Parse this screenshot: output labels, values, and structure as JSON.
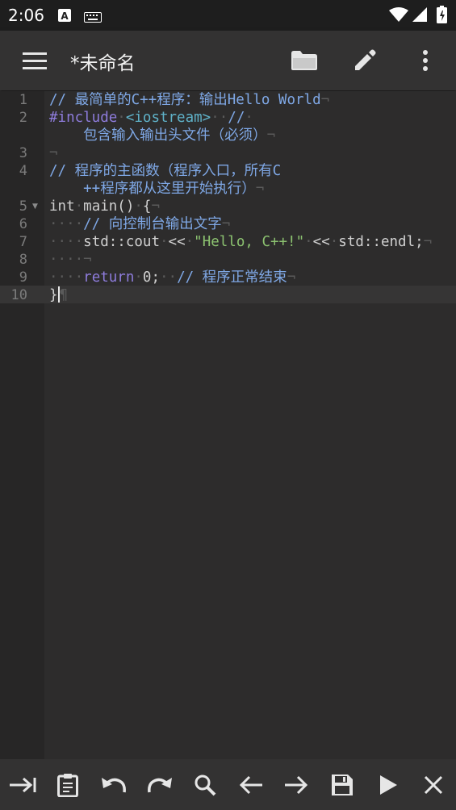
{
  "status_bar": {
    "time": "2:06"
  },
  "app_bar": {
    "title": "*未命名"
  },
  "editor": {
    "line_numbers": [
      "1",
      "2",
      "3",
      "4",
      "5",
      "6",
      "7",
      "8",
      "9",
      "10"
    ],
    "lines": [
      {
        "segments": [
          {
            "cls": "cm",
            "text": "// 最简单的C++程序：输出Hello World"
          },
          {
            "cls": "ws",
            "text": "¬"
          }
        ]
      },
      {
        "segments": [
          {
            "cls": "kw",
            "text": "#include"
          },
          {
            "cls": "ws",
            "text": "·"
          },
          {
            "cls": "inc",
            "text": "<iostream>"
          },
          {
            "cls": "ws",
            "text": "··"
          },
          {
            "cls": "cm",
            "text": "//"
          },
          {
            "cls": "ws",
            "text": "·"
          }
        ]
      },
      {
        "segments": [
          {
            "cls": "cm",
            "text": "    包含输入输出头文件（必须）"
          },
          {
            "cls": "ws",
            "text": "¬"
          }
        ]
      },
      {
        "segments": [
          {
            "cls": "ws",
            "text": "¬"
          }
        ]
      },
      {
        "segments": [
          {
            "cls": "cm",
            "text": "// 程序的主函数（程序入口，所有C"
          }
        ]
      },
      {
        "segments": [
          {
            "cls": "cm",
            "text": "    ++程序都从这里开始执行）"
          },
          {
            "cls": "ws",
            "text": "¬"
          }
        ]
      },
      {
        "segments": [
          {
            "cls": "num",
            "text": "int"
          },
          {
            "cls": "ws",
            "text": "·"
          },
          {
            "cls": "num",
            "text": "main()"
          },
          {
            "cls": "ws",
            "text": "·"
          },
          {
            "cls": "num",
            "text": "{"
          },
          {
            "cls": "ws",
            "text": "¬"
          }
        ]
      },
      {
        "segments": [
          {
            "cls": "ws",
            "text": "····"
          },
          {
            "cls": "cm",
            "text": "// 向控制台输出文字"
          },
          {
            "cls": "ws",
            "text": "¬"
          }
        ]
      },
      {
        "segments": [
          {
            "cls": "ws",
            "text": "····"
          },
          {
            "cls": "num",
            "text": "std::cout"
          },
          {
            "cls": "ws",
            "text": "·"
          },
          {
            "cls": "num",
            "text": "<<"
          },
          {
            "cls": "ws",
            "text": "·"
          },
          {
            "cls": "str",
            "text": "\"Hello, C++!\""
          },
          {
            "cls": "ws",
            "text": "·"
          },
          {
            "cls": "num",
            "text": "<<"
          },
          {
            "cls": "ws",
            "text": "·"
          },
          {
            "cls": "num",
            "text": "std::endl;"
          },
          {
            "cls": "ws",
            "text": "¬"
          }
        ]
      },
      {
        "segments": [
          {
            "cls": "ws",
            "text": "····¬"
          }
        ]
      },
      {
        "segments": [
          {
            "cls": "ws",
            "text": "····"
          },
          {
            "cls": "kw",
            "text": "return"
          },
          {
            "cls": "ws",
            "text": "·"
          },
          {
            "cls": "num",
            "text": "0;"
          },
          {
            "cls": "ws",
            "text": "··"
          },
          {
            "cls": "cm",
            "text": "// 程序正常结束"
          },
          {
            "cls": "ws",
            "text": "¬"
          }
        ]
      },
      {
        "segments": [
          {
            "cls": "num",
            "text": "}"
          },
          {
            "cls": "ws",
            "text": "¶"
          }
        ]
      }
    ]
  },
  "icons": {
    "status": [
      "a-badge-icon",
      "keyboard-icon",
      "wifi-icon",
      "signal-icon",
      "battery-icon"
    ],
    "app_bar": [
      "menu-icon",
      "folder-icon",
      "edit-icon",
      "more-icon"
    ],
    "toolbar": [
      "tab-indent-icon",
      "paste-icon",
      "undo-icon",
      "redo-icon",
      "search-icon",
      "arrow-left-icon",
      "arrow-right-icon",
      "save-icon",
      "run-icon",
      "close-icon"
    ]
  }
}
